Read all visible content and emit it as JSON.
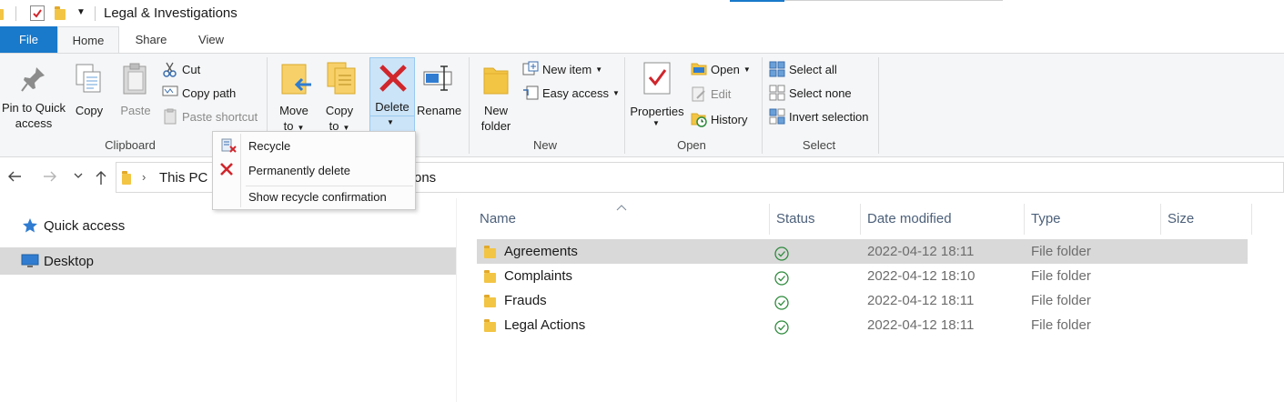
{
  "window": {
    "title": "Legal & Investigations"
  },
  "tabs": [
    {
      "label": "File"
    },
    {
      "label": "Home"
    },
    {
      "label": "Share"
    },
    {
      "label": "View"
    }
  ],
  "ribbon": {
    "clipboard": {
      "group_label": "Clipboard",
      "pin_label_1": "Pin to Quick",
      "pin_label_2": "access",
      "copy_label": "Copy",
      "paste_label": "Paste",
      "cut_label": "Cut",
      "copy_path_label": "Copy path",
      "paste_shortcut_label": "Paste shortcut"
    },
    "organize": {
      "move_label_1": "Move",
      "move_label_2": "to",
      "copy_to_label_1": "Copy",
      "copy_to_label_2": "to",
      "delete_label": "Delete",
      "rename_label": "Rename"
    },
    "new": {
      "group_label": "New",
      "new_folder_label_1": "New",
      "new_folder_label_2": "folder",
      "new_item_label": "New item",
      "easy_access_label": "Easy access"
    },
    "open": {
      "group_label": "Open",
      "properties_label": "Properties",
      "open_label": "Open",
      "edit_label": "Edit",
      "history_label": "History"
    },
    "select": {
      "group_label": "Select",
      "select_all_label": "Select all",
      "select_none_label": "Select none",
      "invert_label": "Invert selection"
    }
  },
  "delete_menu": {
    "recycle": "Recycle",
    "permanently_delete": "Permanently delete",
    "show_confirmation": "Show recycle confirmation"
  },
  "address": {
    "crumb_this_pc": "This PC",
    "crumb_tail": "ons"
  },
  "nav_pane": {
    "quick_access": "Quick access",
    "desktop": "Desktop"
  },
  "file_list": {
    "columns": {
      "name": "Name",
      "status": "Status",
      "date_modified": "Date modified",
      "type": "Type",
      "size": "Size"
    },
    "rows": [
      {
        "name": "Agreements",
        "date": "2022-04-12 18:11",
        "type": "File folder"
      },
      {
        "name": "Complaints",
        "date": "2022-04-12 18:10",
        "type": "File folder"
      },
      {
        "name": "Frauds",
        "date": "2022-04-12 18:11",
        "type": "File folder"
      },
      {
        "name": "Legal Actions",
        "date": "2022-04-12 18:11",
        "type": "File folder"
      }
    ]
  },
  "colors": {
    "accent": "#1979ca",
    "selection": "#d9d9d9",
    "status_ok": "#2e8b3d",
    "delete_red": "#d0262c"
  }
}
